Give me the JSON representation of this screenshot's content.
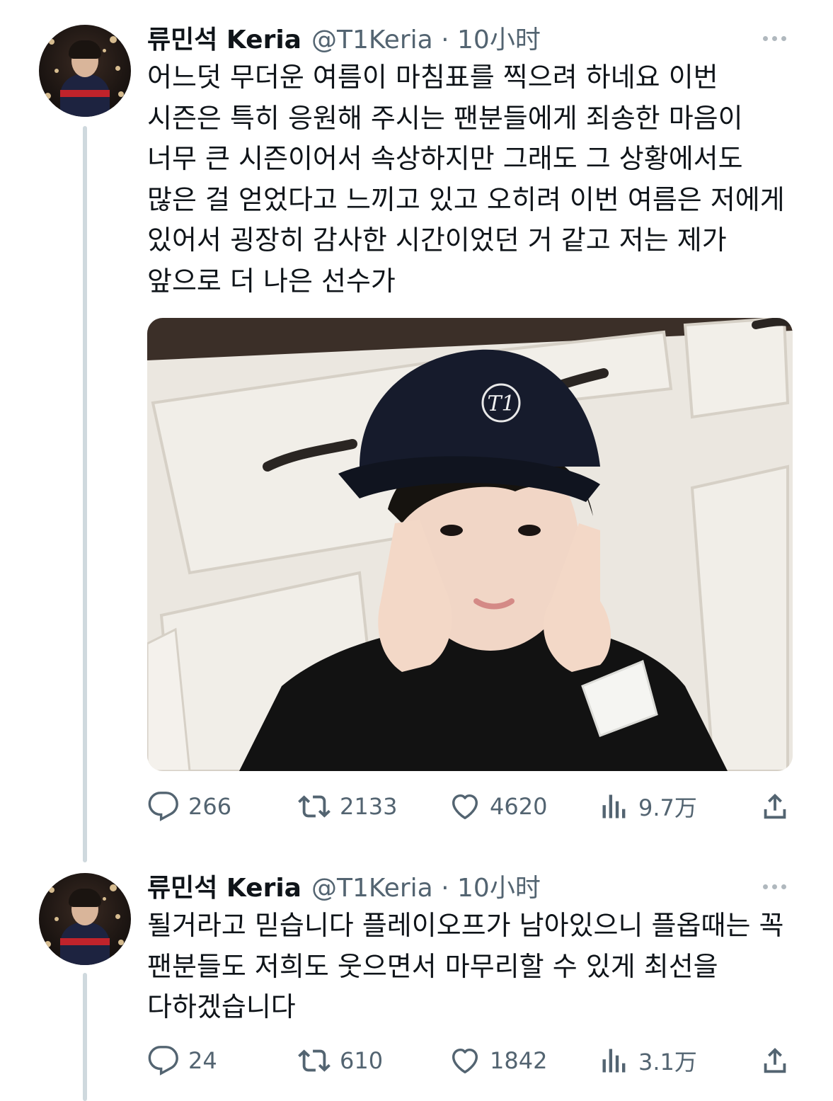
{
  "tweets": [
    {
      "author_name": "류민석 Keria",
      "handle_time": "@T1Keria · 10小时",
      "text": "어느덧 무더운 여름이 마침표를 찍으려 하네요 이번 시즌은 특히 응원해 주시는 팬분들에게 죄송한 마음이 너무 큰 시즌이어서 속상하지만 그래도 그 상황에서도 많은 걸 얻었다고 느끼고 있고 오히려 이번 여름은 저에게 있어서 굉장히 감사한 시간이었던 거 같고 저는 제가 앞으로 더 나은 선수가",
      "replies": "266",
      "retweets": "2133",
      "likes": "4620",
      "views": "9.7万"
    },
    {
      "author_name": "류민석 Keria",
      "handle_time": "@T1Keria · 10小时",
      "text": "될거라고 믿습니다 플레이오프가 남아있으니 플옵때는 꼭 팬분들도 저희도 웃으면서 마무리할 수 있게 최선을 다하겠습니다",
      "replies": "24",
      "retweets": "610",
      "likes": "1842",
      "views": "3.1万"
    }
  ],
  "photo": {
    "description_icon": "photo-icon",
    "colors": {
      "wall": "#ebe7e0",
      "cap": "#161b2c",
      "shirt": "#121212",
      "skin": "#f1d6c6"
    }
  },
  "icons": [
    "reply-icon",
    "retweet-icon",
    "like-icon",
    "views-icon",
    "share-icon",
    "more-icon"
  ],
  "colors": {
    "text": "#0f1419",
    "secondary": "#536471",
    "thread_line": "#cfd9de"
  }
}
